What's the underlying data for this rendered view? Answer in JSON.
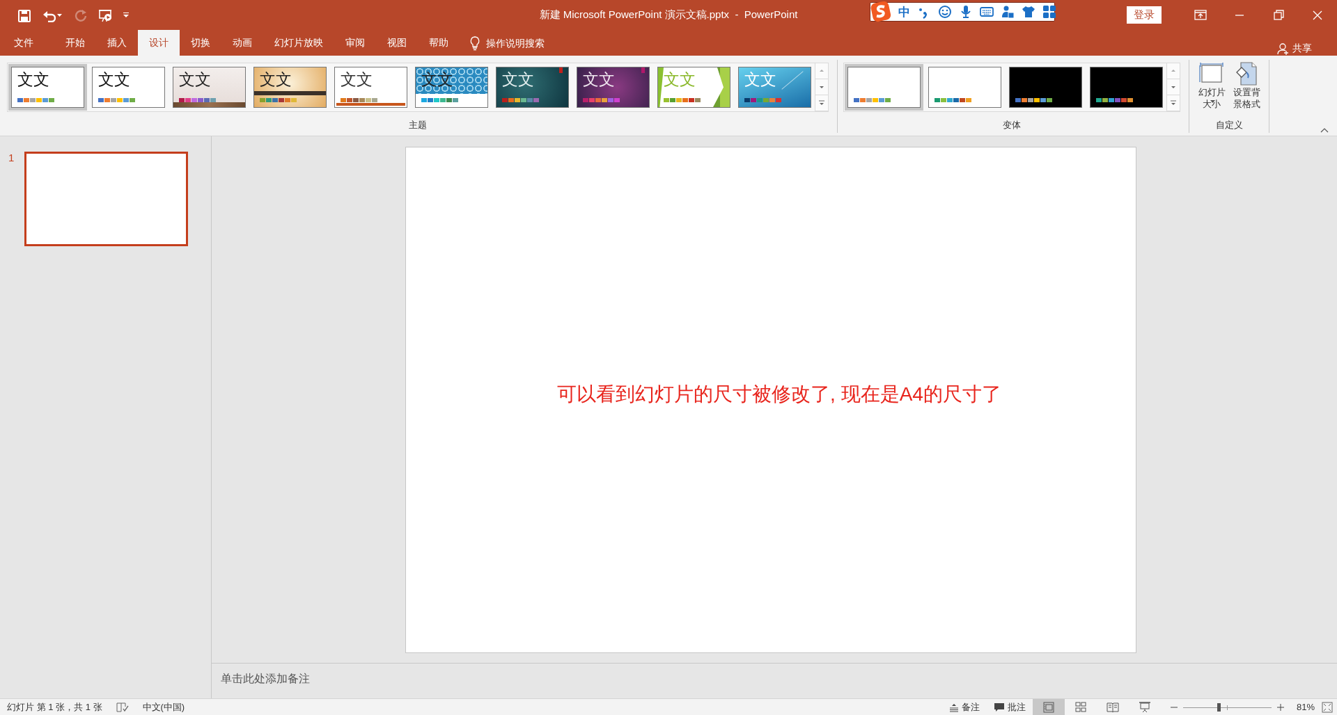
{
  "quick_access": [
    {
      "kind": "save",
      "disabled": false
    },
    {
      "kind": "undo",
      "disabled": false
    },
    {
      "kind": "redo",
      "disabled": true
    },
    {
      "kind": "present",
      "disabled": false
    },
    {
      "kind": "customize",
      "disabled": false
    }
  ],
  "window": {
    "title": "新建 Microsoft PowerPoint 演示文稿.pptx  -  PowerPoint"
  },
  "ime_toolbar": {
    "mode": "中"
  },
  "login_button": "登录",
  "tabs": [
    {
      "label": "文件",
      "selected": false
    },
    {
      "label": "开始",
      "selected": false
    },
    {
      "label": "插入",
      "selected": false
    },
    {
      "label": "设计",
      "selected": true
    },
    {
      "label": "切换",
      "selected": false
    },
    {
      "label": "动画",
      "selected": false
    },
    {
      "label": "幻灯片放映",
      "selected": false
    },
    {
      "label": "审阅",
      "selected": false
    },
    {
      "label": "视图",
      "selected": false
    },
    {
      "label": "帮助",
      "selected": false
    }
  ],
  "tell_me": {
    "placeholder": "操作说明搜索"
  },
  "share": "共享",
  "ribbon": {
    "themes": {
      "label": "主题",
      "items": [
        {
          "sample": "文文",
          "kind": "office",
          "selected": true,
          "swatches": [
            {
              "color": "#4472c4"
            },
            {
              "color": "#ed7d31"
            },
            {
              "color": "#a5a5a5"
            },
            {
              "color": "#ffc000"
            },
            {
              "color": "#5b9bd5"
            },
            {
              "color": "#70ad47"
            }
          ]
        },
        {
          "sample": "文文",
          "kind": "office",
          "selected": false,
          "swatches": [
            {
              "color": "#4472c4"
            },
            {
              "color": "#ed7d31"
            },
            {
              "color": "#a5a5a5"
            },
            {
              "color": "#ffc000"
            },
            {
              "color": "#5b9bd5"
            },
            {
              "color": "#70ad47"
            }
          ]
        },
        {
          "sample": "文文",
          "kind": "paper",
          "selected": false,
          "swatches": [
            {
              "color": "#b31c4a"
            },
            {
              "color": "#e0408a"
            },
            {
              "color": "#c06ae0"
            },
            {
              "color": "#8a5ccc"
            },
            {
              "color": "#5b6cb5"
            },
            {
              "color": "#6fa0b0"
            }
          ]
        },
        {
          "sample": "文文",
          "kind": "banner",
          "selected": false,
          "swatches": [
            {
              "color": "#8aa02c"
            },
            {
              "color": "#2e9a7a"
            },
            {
              "color": "#3e72a8"
            },
            {
              "color": "#a83838"
            },
            {
              "color": "#e07a28"
            },
            {
              "color": "#e0b838"
            }
          ]
        },
        {
          "sample": "文文",
          "kind": "line",
          "selected": false,
          "swatches": [
            {
              "color": "#e07a1c"
            },
            {
              "color": "#c0562c"
            },
            {
              "color": "#8a5a44"
            },
            {
              "color": "#a88a5a"
            },
            {
              "color": "#c8c08a"
            },
            {
              "color": "#a8a890"
            }
          ]
        },
        {
          "sample": "文文",
          "kind": "pattern",
          "selected": false,
          "swatches": [
            {
              "color": "#1ca8e0"
            },
            {
              "color": "#2080c8"
            },
            {
              "color": "#20c8c8"
            },
            {
              "color": "#3cb890"
            },
            {
              "color": "#3c8a50"
            },
            {
              "color": "#5aa0a0"
            }
          ]
        },
        {
          "sample": "文文",
          "kind": "teal",
          "selected": false,
          "swatches": [
            {
              "color": "#b8201c"
            },
            {
              "color": "#e86a1c"
            },
            {
              "color": "#e8b82c"
            },
            {
              "color": "#6ab890"
            },
            {
              "color": "#5a88a8"
            },
            {
              "color": "#9a6ab0"
            }
          ]
        },
        {
          "sample": "文文",
          "kind": "purple",
          "selected": false,
          "swatches": [
            {
              "color": "#b8206a"
            },
            {
              "color": "#e8406a"
            },
            {
              "color": "#e86a3c"
            },
            {
              "color": "#e8a03c"
            },
            {
              "color": "#a060e0"
            },
            {
              "color": "#d040d0"
            }
          ]
        },
        {
          "sample": "文文",
          "kind": "facet",
          "selected": false,
          "swatches": [
            {
              "color": "#98c030"
            },
            {
              "color": "#58a030"
            },
            {
              "color": "#e8b820"
            },
            {
              "color": "#e8701c"
            },
            {
              "color": "#c83020"
            },
            {
              "color": "#9a8a60"
            }
          ]
        },
        {
          "sample": "文文",
          "kind": "blue",
          "selected": false,
          "swatches": [
            {
              "color": "#0a3a6a"
            },
            {
              "color": "#a01a7a"
            },
            {
              "color": "#1a9a8a"
            },
            {
              "color": "#78a830"
            },
            {
              "color": "#e8803c"
            },
            {
              "color": "#d83030"
            }
          ]
        }
      ]
    },
    "variants": {
      "label": "变体",
      "items": [
        {
          "kind": "light",
          "selected": true,
          "swatches": [
            {
              "color": "#4472c4"
            },
            {
              "color": "#ed7d31"
            },
            {
              "color": "#a5a5a5"
            },
            {
              "color": "#ffc000"
            },
            {
              "color": "#5b9bd5"
            },
            {
              "color": "#70ad47"
            }
          ]
        },
        {
          "kind": "light",
          "selected": false,
          "swatches": [
            {
              "color": "#1a9a70"
            },
            {
              "color": "#8ac040"
            },
            {
              "color": "#30a8d0"
            },
            {
              "color": "#1a6aa8"
            },
            {
              "color": "#c04820"
            },
            {
              "color": "#f0a020"
            }
          ]
        },
        {
          "kind": "dark",
          "selected": false,
          "swatches": [
            {
              "color": "#4472c4"
            },
            {
              "color": "#ed7d31"
            },
            {
              "color": "#a5a5a5"
            },
            {
              "color": "#ffc000"
            },
            {
              "color": "#5b9bd5"
            },
            {
              "color": "#70ad47"
            }
          ]
        },
        {
          "kind": "dark",
          "selected": false,
          "swatches": [
            {
              "color": "#20a890"
            },
            {
              "color": "#90b040"
            },
            {
              "color": "#30a0d0"
            },
            {
              "color": "#8050c0"
            },
            {
              "color": "#d04830"
            },
            {
              "color": "#e09030"
            }
          ]
        }
      ]
    },
    "customize": {
      "label": "自定义",
      "buttons": [
        {
          "kind": "slide-size",
          "label": "幻灯片大小",
          "dropdown": true
        },
        {
          "kind": "format-background",
          "label": "设置背景格式",
          "dropdown": false
        }
      ]
    }
  },
  "slides": [
    {
      "number": "1",
      "selected": true
    }
  ],
  "slide": {
    "text": "可以看到幻灯片的尺寸被修改了, 现在是A4的尺寸了"
  },
  "notes_placeholder": "单击此处添加备注",
  "status_bar": {
    "slide_info": "幻灯片 第 1 张，共 1 张",
    "language": "中文(中国)",
    "notes": "备注",
    "comments": "批注",
    "views": [
      {
        "kind": "normal",
        "selected": true
      },
      {
        "kind": "sorter",
        "selected": false
      },
      {
        "kind": "reading",
        "selected": false
      },
      {
        "kind": "slideshow",
        "selected": false
      }
    ],
    "zoom": {
      "level": 0.4,
      "reading": "81%"
    }
  }
}
